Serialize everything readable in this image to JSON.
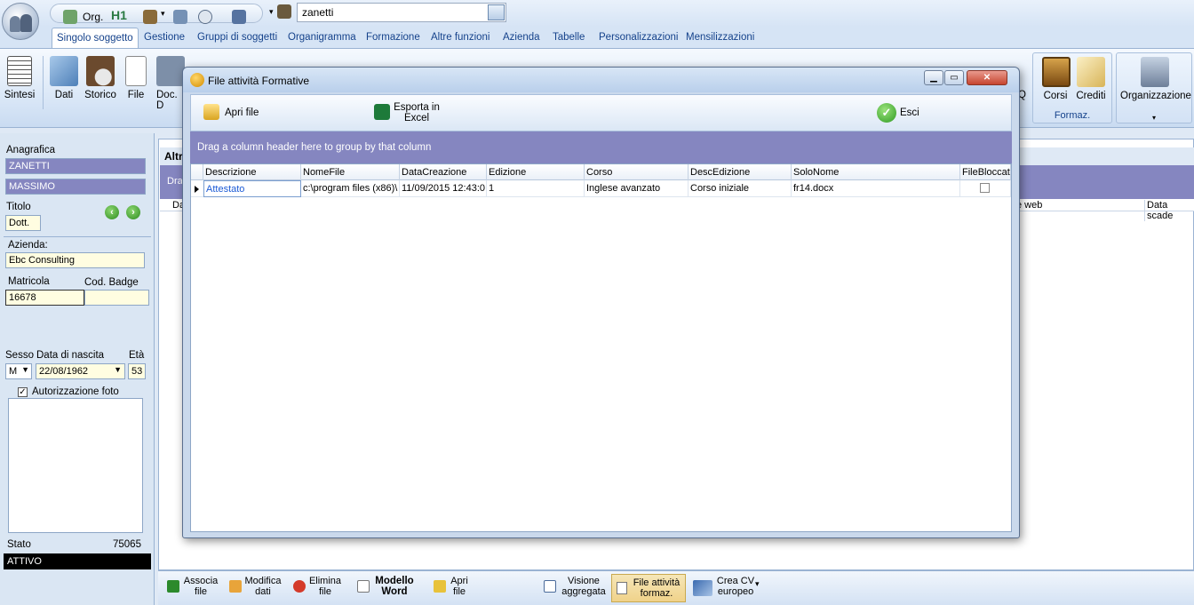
{
  "qat": {
    "org_label": "Org.",
    "h1_label": "H1",
    "search_value": "zanetti"
  },
  "tabs": [
    "Singolo soggetto",
    "Gestione",
    "Gruppi di soggetti",
    "Organigramma",
    "Formazione",
    "Altre funzioni",
    "Azienda",
    "Tabelle",
    "Personalizzazioni",
    "Mensilizzazioni"
  ],
  "ribbon": {
    "left_buttons": [
      "Sintesi",
      "Dati",
      "Storico",
      "File",
      "Doc. D"
    ],
    "right_q": "Q",
    "formaz_buttons": [
      "Corsi",
      "Crediti"
    ],
    "formaz_group": "Formaz.",
    "org_button": "Organizzazione"
  },
  "left": {
    "anagrafica_label": "Anagrafica",
    "surname": "ZANETTI",
    "name": "MASSIMO",
    "titolo_label": "Titolo",
    "titolo": "Dott.",
    "azienda_label": "Azienda:",
    "azienda": "Ebc Consulting",
    "matricola_label": "Matricola",
    "badge_label": "Cod. Badge",
    "matricola": "16678",
    "badge": "",
    "sesso_label": "Sesso",
    "nascita_label": "Data di nascita",
    "eta_label": "Età",
    "sesso": "M",
    "nascita": "22/08/1962",
    "eta": "53",
    "foto_label": "Autorizzazione foto",
    "stato_label": "Stato",
    "stato_code": "75065",
    "stato": "ATTIVO"
  },
  "background": {
    "header": "Altr",
    "drag": "Drag",
    "col_da": "Da",
    "col_web": "e web",
    "col_scad": "Data scade"
  },
  "bottom": [
    {
      "l1": "Associa",
      "l2": "file"
    },
    {
      "l1": "Modifica",
      "l2": "dati"
    },
    {
      "l1": "Elimina",
      "l2": "file"
    },
    {
      "l1": "Modello",
      "l2": "Word"
    },
    {
      "l1": "Apri",
      "l2": "file"
    },
    {
      "l1": "Visione",
      "l2": "aggregata"
    },
    {
      "l1": "File attività",
      "l2": "formaz."
    },
    {
      "l1": "Crea CV",
      "l2": "europeo"
    }
  ],
  "dialog": {
    "title": "File attività Formative",
    "apri_file": "Apri file",
    "esporta_l1": "Esporta in",
    "esporta_l2": "Excel",
    "esci": "Esci",
    "group_hint": "Drag a column header here to group by that column",
    "columns": [
      "Descrizione",
      "NomeFile",
      "DataCreazione",
      "Edizione",
      "Corso",
      "DescEdizione",
      "SoloNome",
      "FileBloccato"
    ],
    "rows": [
      [
        "Attestato",
        "c:\\program files (x86)\\",
        "11/09/2015 12:43:0",
        "1",
        "Inglese avanzato",
        "Corso iniziale",
        "fr14.docx",
        ""
      ]
    ]
  },
  "colors": {
    "purple_band": "#8586c0",
    "ribbon_blue": "#d7e5f6",
    "title_blue": "#15428b"
  }
}
